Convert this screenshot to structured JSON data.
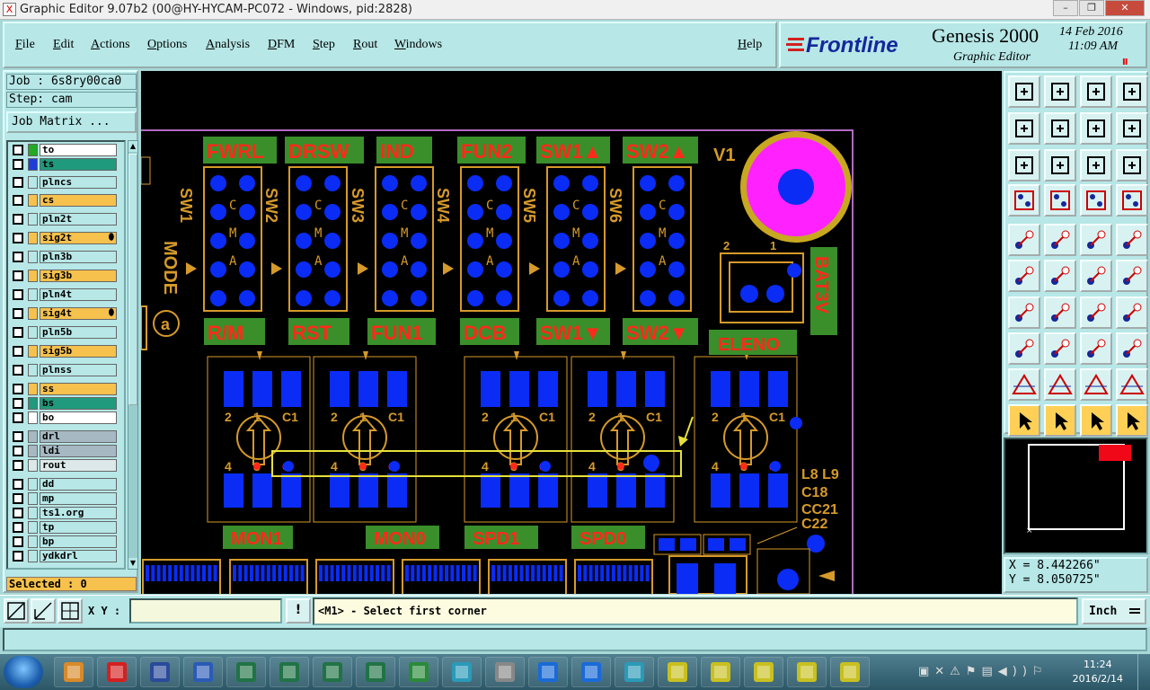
{
  "window": {
    "title": "Graphic Editor 9.07b2 (00@HY-HYCAM-PC072 - Windows, pid:2828)",
    "app_icon": "X"
  },
  "menu": {
    "items": [
      "File",
      "Edit",
      "Actions",
      "Options",
      "Analysis",
      "DFM",
      "Step",
      "Rout",
      "Windows"
    ],
    "help": "Help"
  },
  "brand": {
    "logo_text": "Frontline",
    "product": "Genesis 2000",
    "subtitle": "Graphic Editor",
    "date": "14 Feb 2016",
    "time": "11:09  AM",
    "pause": "II"
  },
  "job": {
    "job_line": "Job : 6s8ry00ca0",
    "step_line": "Step: cam",
    "matrix_button": "Job Matrix ..."
  },
  "layers": [
    {
      "name": "to",
      "color": "#ffffff",
      "swatch": "#22aa22",
      "locked": false
    },
    {
      "name": "ts",
      "color": "#1f9a7c",
      "swatch": "#1f3dd8",
      "locked": false
    },
    {
      "name": "plncs",
      "color": "#b7e7e7",
      "swatch": "",
      "locked": false
    },
    {
      "name": "cs",
      "color": "#f6c14c",
      "swatch": "",
      "locked": false
    },
    {
      "name": "pln2t",
      "color": "#b7e7e7",
      "swatch": "",
      "locked": false
    },
    {
      "name": "sig2t",
      "color": "#f6c14c",
      "swatch": "",
      "locked": true
    },
    {
      "name": "pln3b",
      "color": "#b7e7e7",
      "swatch": "",
      "locked": false
    },
    {
      "name": "sig3b",
      "color": "#f6c14c",
      "swatch": "",
      "locked": false
    },
    {
      "name": "pln4t",
      "color": "#b7e7e7",
      "swatch": "",
      "locked": false
    },
    {
      "name": "sig4t",
      "color": "#f6c14c",
      "swatch": "",
      "locked": true
    },
    {
      "name": "pln5b",
      "color": "#b7e7e7",
      "swatch": "",
      "locked": false
    },
    {
      "name": "sig5b",
      "color": "#f6c14c",
      "swatch": "",
      "locked": false
    },
    {
      "name": "plnss",
      "color": "#b7e7e7",
      "swatch": "",
      "locked": false
    },
    {
      "name": "ss",
      "color": "#f6c14c",
      "swatch": "",
      "locked": false
    },
    {
      "name": "bs",
      "color": "#1f9a7c",
      "swatch": "",
      "locked": false
    },
    {
      "name": "bo",
      "color": "#ffffff",
      "swatch": "",
      "locked": false
    },
    {
      "name": "drl",
      "color": "#a6b8c2",
      "swatch": "",
      "locked": false
    },
    {
      "name": "ldi",
      "color": "#a6b8c2",
      "swatch": "",
      "locked": false
    },
    {
      "name": "rout",
      "color": "#dde8ea",
      "swatch": "",
      "locked": false
    },
    {
      "name": "dd",
      "color": "#b7e7e7",
      "swatch": "",
      "locked": false
    },
    {
      "name": "mp",
      "color": "#b7e7e7",
      "swatch": "",
      "locked": false
    },
    {
      "name": "ts1.org",
      "color": "#b7e7e7",
      "swatch": "",
      "locked": false
    },
    {
      "name": "tp",
      "color": "#b7e7e7",
      "swatch": "",
      "locked": false
    },
    {
      "name": "bp",
      "color": "#b7e7e7",
      "swatch": "",
      "locked": false
    },
    {
      "name": "ydkdrl",
      "color": "#b7e7e7",
      "swatch": "",
      "locked": false
    }
  ],
  "selected": "Selected : 0",
  "coords": {
    "x": "X = 8.442266\"",
    "y": "Y = 8.050725\""
  },
  "command": {
    "xy_label": "X Y :",
    "xy_value": "",
    "excl": "!",
    "prompt": "<M1> - Select first corner",
    "unit": "Inch"
  },
  "taskbar": {
    "clock_time": "11:24",
    "clock_date": "2016/2/14"
  },
  "pcb": {
    "top_labels": [
      "FWRL",
      "DRSW",
      "IND",
      "FUN2",
      "SW1▲",
      "SW2▲"
    ],
    "bottom_labels": [
      "R/M",
      "RST",
      "FUN1",
      "DCB",
      "SW1▼",
      "SW2▼"
    ],
    "switch_labels": [
      "SW1",
      "SW2",
      "SW3",
      "SW4",
      "SW5",
      "SW6"
    ],
    "cma": [
      "C",
      "M",
      "A"
    ],
    "mode": "MODE",
    "a": "a",
    "v1": "V1",
    "bat": "BAT3V",
    "bat_pins": [
      "2",
      "1"
    ],
    "eleno": "ELENO",
    "mon_labels": [
      "MON1",
      "MON0",
      "SPD1",
      "SPD0"
    ],
    "pin_labels": [
      "2",
      "1",
      "C1",
      "4",
      "3",
      "C"
    ],
    "side_labels": [
      "L8 L9",
      "C18",
      "CC21",
      "C22"
    ]
  },
  "colors": {
    "label_green": "#3a8f2a",
    "label_red": "#ff2a1a",
    "pad_blue": "#0a2cf5",
    "outline": "#d69a2a",
    "magenta": "#ff22ff",
    "select_box": "#e6e13a"
  }
}
